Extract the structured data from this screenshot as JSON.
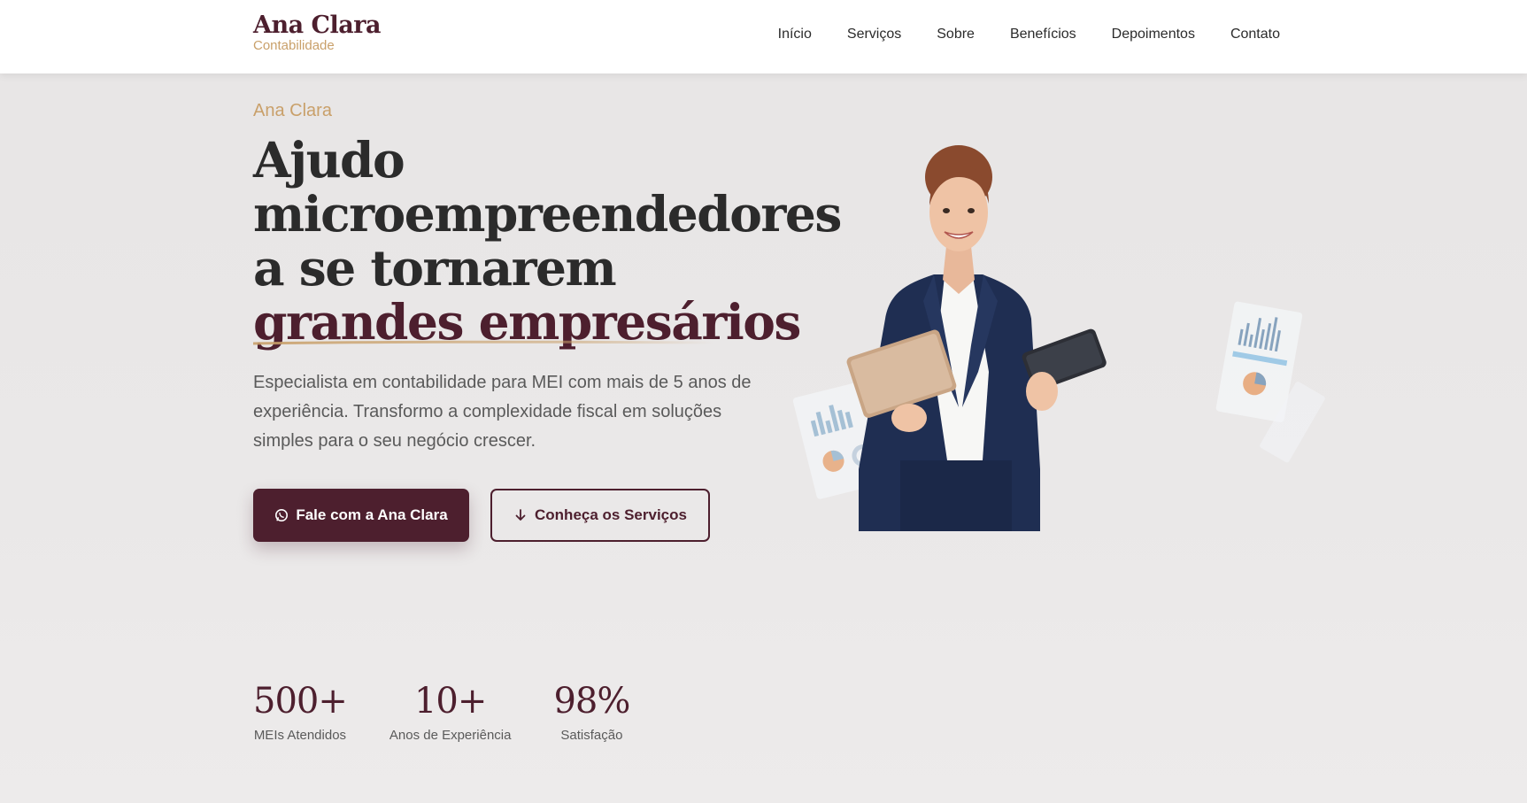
{
  "header": {
    "logo_name": "Ana Clara",
    "logo_sub": "Contabilidade",
    "nav": [
      "Início",
      "Serviços",
      "Sobre",
      "Benefícios",
      "Depoimentos",
      "Contato"
    ]
  },
  "hero": {
    "eyebrow": "Ana Clara",
    "headline_lines": [
      "Ajudo",
      "microempreendedores",
      "a se tornarem"
    ],
    "headline_accent": "grandes empresários",
    "lead": "Especialista em contabilidade para MEI com mais de 5 anos de experiência. Transformo a complexidade fiscal em soluções simples para o seu negócio crescer.",
    "primary_button": "Fale com a Ana Clara",
    "secondary_button": "Conheça os Serviços"
  },
  "stats": [
    {
      "value": "500+",
      "label": "MEIs Atendidos"
    },
    {
      "value": "10+",
      "label": "Anos de Experiência"
    },
    {
      "value": "98%",
      "label": "Satisfação"
    }
  ],
  "icons": {
    "primary_button_icon": "whatsapp-icon",
    "secondary_button_icon": "arrow-down-icon"
  },
  "colors": {
    "brand": "#4d1f2e",
    "accent_gold": "#c9a06a",
    "text": "#2b2b2b",
    "muted": "#5a5a5a"
  }
}
